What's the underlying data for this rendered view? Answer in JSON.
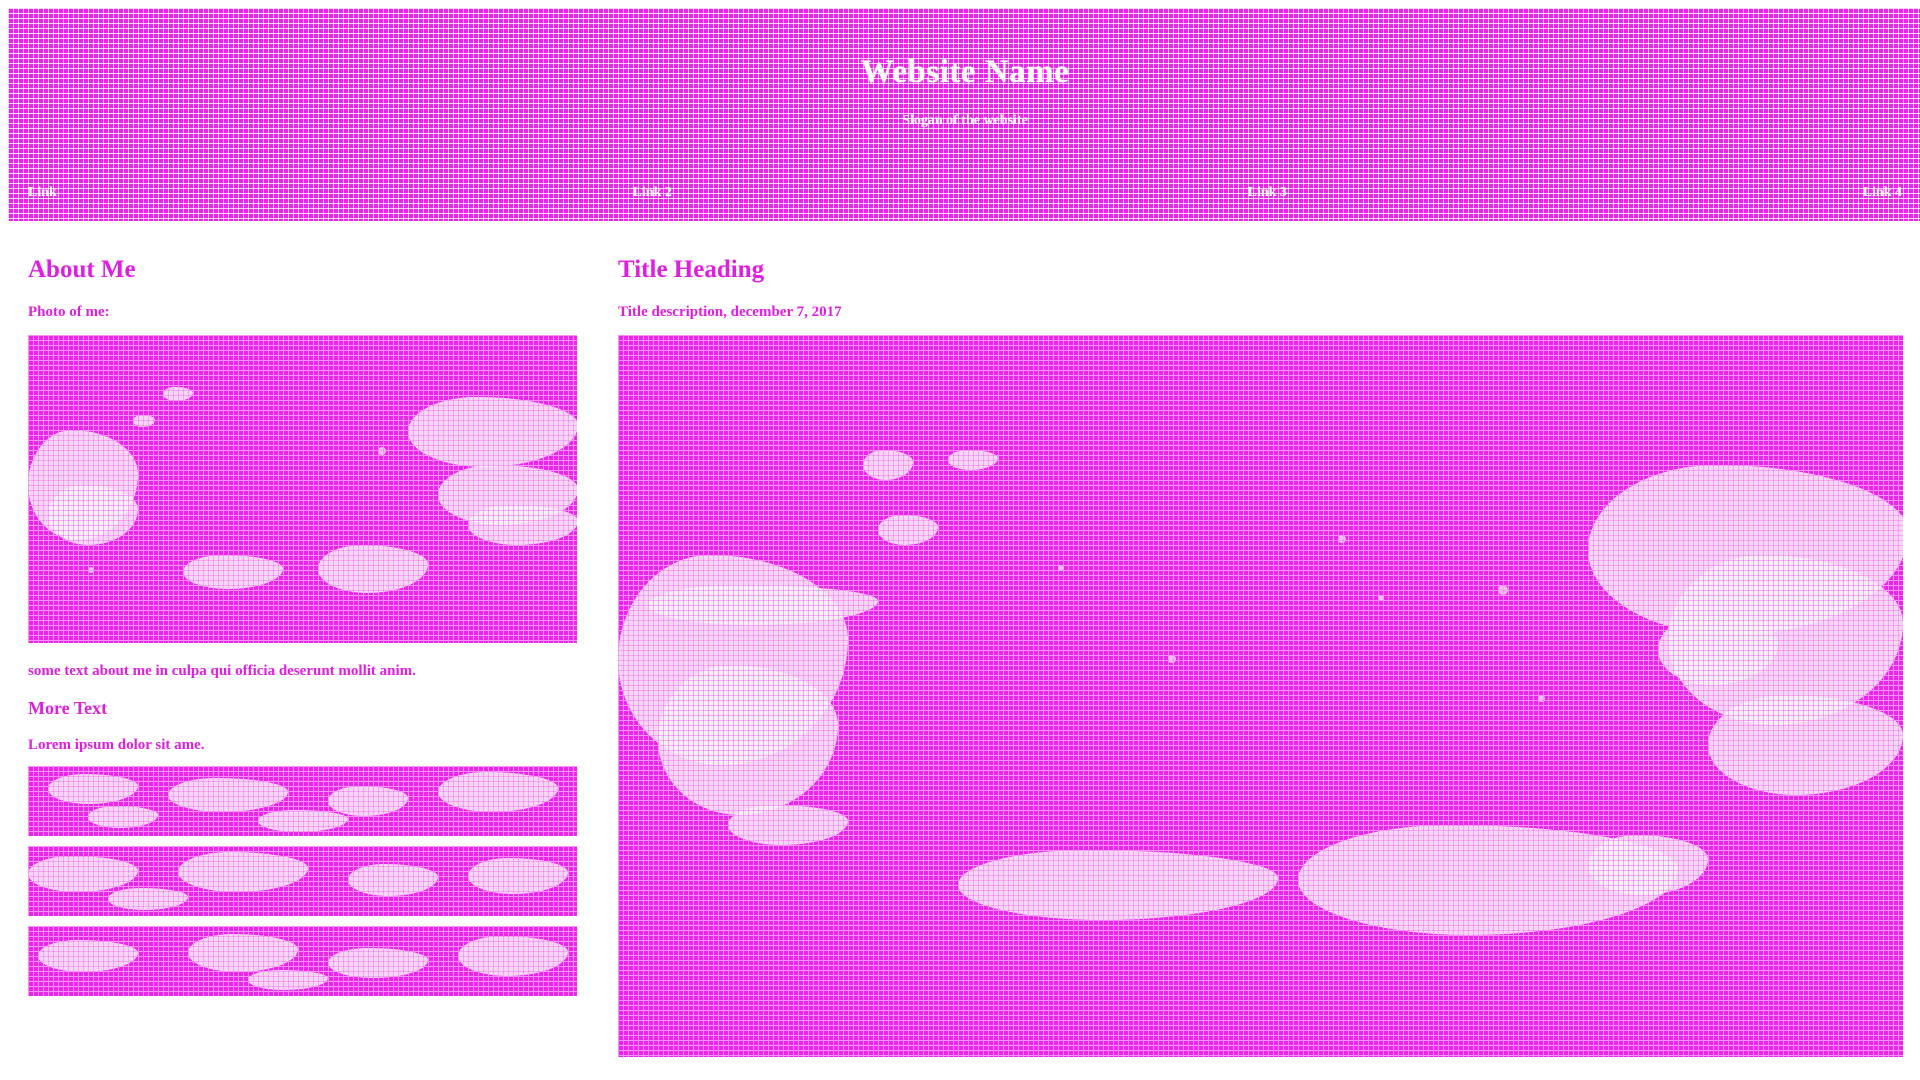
{
  "header": {
    "site_title": "Website Name",
    "slogan": "Slogan of the website",
    "nav": [
      "Link",
      "Link 2",
      "Link 3",
      "Link 4"
    ]
  },
  "sidebar": {
    "heading": "About Me",
    "photo_label": "Photo of me:",
    "about_text": "some text about me in culpa qui officia deserunt mollit anim.",
    "more_heading": "More Text",
    "more_text": "Lorem ipsum dolor sit ame."
  },
  "main": {
    "title": "Title Heading",
    "description": "Title description, december 7, 2017"
  },
  "colors": {
    "accent": "#e01ee0",
    "grid_fill": "#ef23ef",
    "background": "#ffffff"
  }
}
